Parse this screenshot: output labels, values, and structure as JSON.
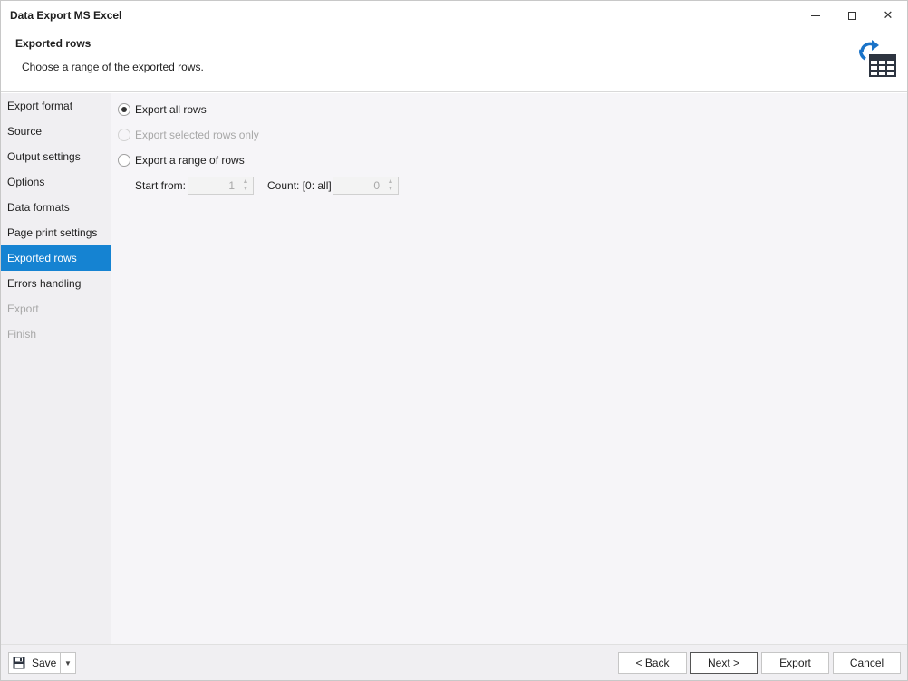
{
  "window": {
    "title": "Data Export MS Excel",
    "controls": {
      "minimize": "minimize-icon",
      "maximize": "maximize-icon",
      "close": "close-icon",
      "close_glyph": "✕"
    }
  },
  "header": {
    "title": "Exported rows",
    "description": "Choose a range of the exported rows.",
    "icon": "export-table-icon"
  },
  "sidebar": {
    "items": [
      {
        "label": "Export format",
        "state": "normal"
      },
      {
        "label": "Source",
        "state": "normal"
      },
      {
        "label": "Output settings",
        "state": "normal"
      },
      {
        "label": "Options",
        "state": "normal"
      },
      {
        "label": "Data formats",
        "state": "normal"
      },
      {
        "label": "Page print settings",
        "state": "normal"
      },
      {
        "label": "Exported rows",
        "state": "active"
      },
      {
        "label": "Errors handling",
        "state": "normal"
      },
      {
        "label": "Export",
        "state": "disabled"
      },
      {
        "label": "Finish",
        "state": "disabled"
      }
    ]
  },
  "main": {
    "options": [
      {
        "label": "Export all rows",
        "checked": true,
        "disabled": false
      },
      {
        "label": "Export selected rows only",
        "checked": false,
        "disabled": true
      },
      {
        "label": "Export a range of rows",
        "checked": false,
        "disabled": false
      }
    ],
    "start_from": {
      "label": "Start from:",
      "value": "1"
    },
    "count": {
      "label": "Count: [0: all]",
      "value": "0"
    }
  },
  "footer": {
    "save_label": "Save",
    "save_dropdown_glyph": "▼",
    "back_label": "< Back",
    "next_label": "Next >",
    "export_label": "Export",
    "cancel_label": "Cancel"
  },
  "colors": {
    "accent": "#1583d2",
    "sidebar_bg": "#f0eff2",
    "content_bg": "#f6f5f8",
    "disabled_text": "#a8a8a8",
    "icon_blue": "#1a73c8",
    "icon_dark": "#2d3440"
  }
}
